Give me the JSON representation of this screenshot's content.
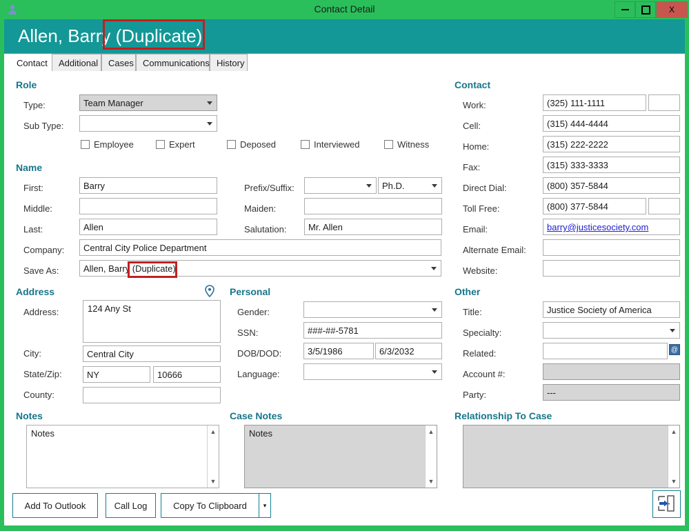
{
  "window": {
    "title": "Contact Detail",
    "icon": "contact-person-icon",
    "controls": {
      "minimize": "–",
      "maximize": "□",
      "close": "X"
    },
    "colors": {
      "frame_green": "#2BBF5B",
      "banner_teal": "#139797",
      "section_heading": "#16768a",
      "highlight_red": "#c0201f",
      "close_red": "#c9554f"
    }
  },
  "banner": {
    "title": "Allen, Barry (Duplicate)",
    "highlight_text": "(Duplicate)"
  },
  "tabs": [
    {
      "label": "Contact",
      "active": true
    },
    {
      "label": "Additional",
      "active": false
    },
    {
      "label": "Cases",
      "active": false
    },
    {
      "label": "Communications",
      "active": false
    },
    {
      "label": "History",
      "active": false
    }
  ],
  "sections": {
    "role": "Role",
    "name": "Name",
    "address": "Address",
    "personal": "Personal",
    "contact": "Contact",
    "other": "Other",
    "notes": "Notes",
    "case_notes": "Case Notes",
    "relationship_to_case": "Relationship To Case"
  },
  "role": {
    "type_label": "Type:",
    "type_value": "Team Manager",
    "subtype_label": "Sub Type:",
    "subtype_value": "",
    "checkboxes": [
      {
        "label": "Employee",
        "checked": false
      },
      {
        "label": "Expert",
        "checked": false
      },
      {
        "label": "Deposed",
        "checked": false
      },
      {
        "label": "Interviewed",
        "checked": false
      },
      {
        "label": "Witness",
        "checked": false
      }
    ]
  },
  "name": {
    "first_label": "First:",
    "first_value": "Barry",
    "middle_label": "Middle:",
    "middle_value": "",
    "last_label": "Last:",
    "last_value": "Allen",
    "company_label": "Company:",
    "company_value": "Central City Police Department",
    "save_as_label": "Save As:",
    "save_as_value": "Allen, Barry (Duplicate)",
    "prefix_suffix_label": "Prefix/Suffix:",
    "prefix_value": "",
    "suffix_value": "Ph.D.",
    "maiden_label": "Maiden:",
    "maiden_value": "",
    "salutation_label": "Salutation:",
    "salutation_value": "Mr. Allen"
  },
  "address": {
    "address_label": "Address:",
    "address_value": "124 Any St",
    "city_label": "City:",
    "city_value": "Central City",
    "state_zip_label": "State/Zip:",
    "state_value": "NY",
    "zip_value": "10666",
    "county_label": "County:",
    "county_value": "",
    "map_icon": "map-pin-icon"
  },
  "personal": {
    "gender_label": "Gender:",
    "gender_value": "",
    "ssn_label": "SSN:",
    "ssn_value": "###-##-5781",
    "dob_dod_label": "DOB/DOD:",
    "dob_value": "3/5/1986",
    "dod_value": "6/3/2032",
    "language_label": "Language:",
    "language_value": ""
  },
  "contact": {
    "work_label": "Work:",
    "work_value": "(325) 111-1111",
    "work_ext": "",
    "cell_label": "Cell:",
    "cell_value": "(315) 444-4444",
    "home_label": "Home:",
    "home_value": "(315) 222-2222",
    "fax_label": "Fax:",
    "fax_value": "(315) 333-3333",
    "direct_dial_label": "Direct Dial:",
    "direct_dial_value": "(800) 357-5844",
    "toll_free_label": "Toll Free:",
    "toll_free_value": "(800) 377-5844",
    "toll_free_ext": "",
    "email_label": "Email:",
    "email_value": "barry@justicesociety.com",
    "alternate_email_label": "Alternate Email:",
    "alternate_email_value": "",
    "website_label": "Website:",
    "website_value": ""
  },
  "other": {
    "title_label": "Title:",
    "title_value": "Justice Society of America",
    "specialty_label": "Specialty:",
    "specialty_value": "",
    "related_label": "Related:",
    "related_value": "",
    "related_icon": "at-sign-button-icon",
    "account_label": "Account #:",
    "account_value": "",
    "party_label": "Party:",
    "party_value": "---"
  },
  "notes": {
    "value": "Notes"
  },
  "case_notes": {
    "value": "Notes"
  },
  "relationship_to_case": {
    "value": ""
  },
  "footer": {
    "add_to_outlook": "Add To Outlook",
    "call_log": "Call Log",
    "copy_to_clipboard": "Copy To Clipboard",
    "copy_dropdown_glyph": "▾",
    "save_close_icon": "save-and-exit-icon"
  }
}
